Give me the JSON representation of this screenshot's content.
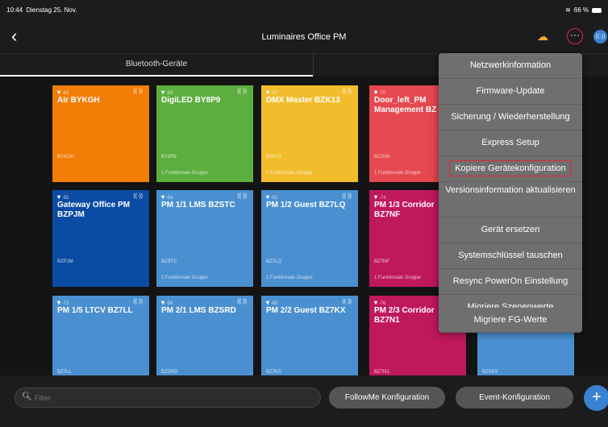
{
  "status": {
    "time": "10:44",
    "date": "Dienstag 25. Nov.",
    "battery": "66 %"
  },
  "nav": {
    "back_icon": "‹",
    "title": "Luminaires Office PM",
    "more_icon": "···"
  },
  "tabs": [
    {
      "label": "Bluetooth-Geräte"
    },
    {
      "label": ""
    }
  ],
  "tiles": [
    {
      "name": "Air BYKGH",
      "code": "BYKGH",
      "sig": "-65",
      "group": "",
      "color": "#f27d07"
    },
    {
      "name": "DigiLED BY8P9",
      "code": "BY8P9",
      "sig": "-68",
      "group": "1 Funktionale Gruppe",
      "color": "#5cae3f"
    },
    {
      "name": "DMX Master BZK13",
      "code": "BZK13",
      "sig": "-67",
      "group": "1 Funktionale Gruppe",
      "color": "#f2bd2c"
    },
    {
      "name": "Door_left_PM Management BZ",
      "code": "BZ2MX",
      "sig": "-70",
      "group": "1 Funktionale Gruppe",
      "color": "#e5484f"
    },
    {
      "name": "Gateway Office PM BZPJM",
      "code": "BZPJM",
      "sig": "-55",
      "group": "",
      "color": "#0a4ba3"
    },
    {
      "name": "PM 1/1  LMS BZSTC",
      "code": "BZSTC",
      "sig": "-54",
      "group": "1 Funktionale Gruppe",
      "color": "#4a90d0"
    },
    {
      "name": "PM 1/2 Guest BZ7LQ",
      "code": "BZ7LQ",
      "sig": "-62",
      "group": "1 Funktionale Gruppe",
      "color": "#4a90d0"
    },
    {
      "name": "PM 1/3 Corridor BZ7NF",
      "code": "BZ7NF",
      "sig": "-74",
      "group": "1 Funktionale Gruppe",
      "color": "#c0185c"
    },
    {
      "name": "PM 1/5 LTCV BZ7LL",
      "code": "BZ7LL",
      "sig": "-72",
      "group": "",
      "color": "#4a90d0"
    },
    {
      "name": "PM 2/1 LMS BZSRD",
      "code": "BZSRD",
      "sig": "-58",
      "group": "",
      "color": "#4a90d0"
    },
    {
      "name": "PM 2/2 Guest BZ7KX",
      "code": "BZ7KX",
      "sig": "-65",
      "group": "",
      "color": "#4a90d0"
    },
    {
      "name": "PM 2/3 Corridor BZ7N1",
      "code": "BZ7N1",
      "sig": "-76",
      "group": "",
      "color": "#c0185c"
    },
    {
      "name": "",
      "code": "BZSP3",
      "sig": "",
      "group": "",
      "color": "#4a90d0"
    }
  ],
  "menu": [
    {
      "label": "Netzwerkinformation"
    },
    {
      "label": "Firmware-Update"
    },
    {
      "label": "Sicherung / Wiederherstellung"
    },
    {
      "label": "Express Setup"
    },
    {
      "label": "Kopiere Gerätekonfiguration"
    },
    {
      "label": "Versionsinformation aktualisieren"
    },
    {
      "label": "Gerät ersetzen"
    },
    {
      "label": "Systemschlüssel tauschen"
    },
    {
      "label": "Resync PowerOn Einstellung"
    },
    {
      "label": "Migriere Szenenwerte"
    },
    {
      "label": "Migriere FG-Werte"
    }
  ],
  "bottom": {
    "filter_placeholder": "Filter",
    "followme": "FollowMe Konfiguration",
    "event": "Event-Konfiguration",
    "add": "+"
  },
  "colors": {
    "highlight": "#e2263a",
    "accent": "#3a82d0"
  }
}
